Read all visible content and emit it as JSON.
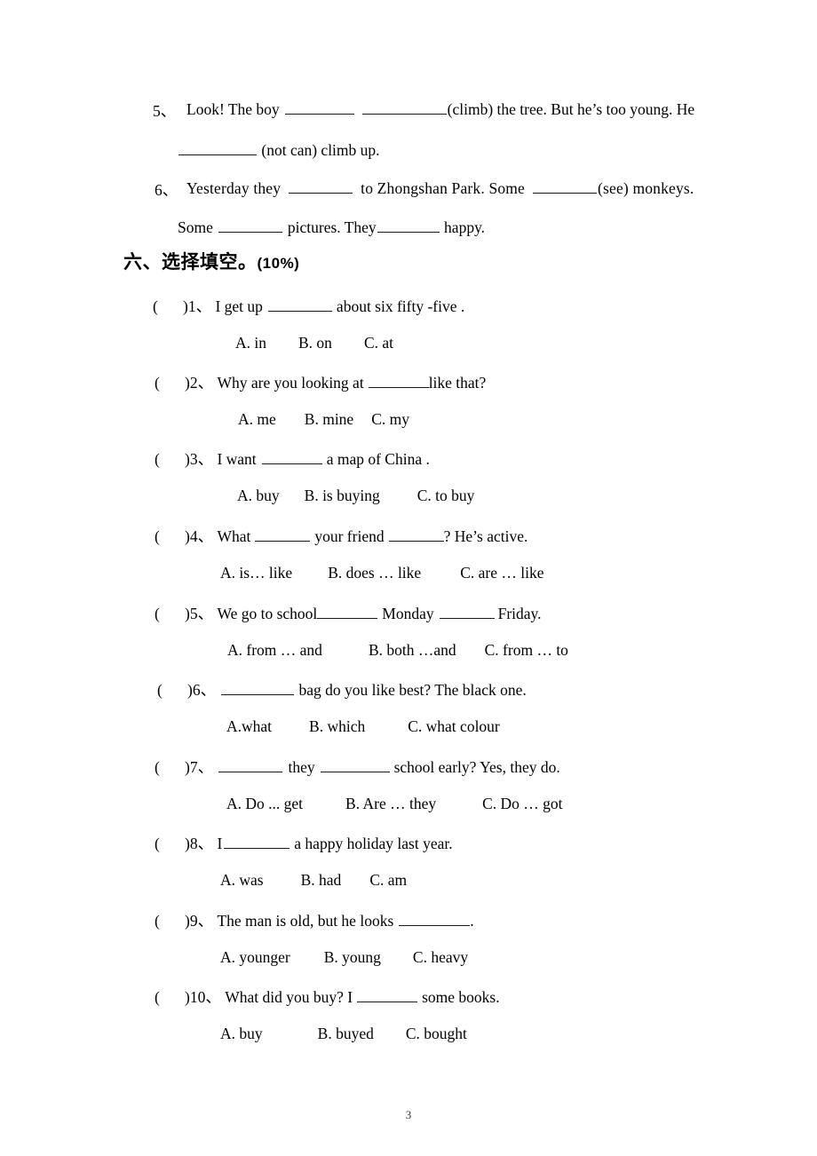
{
  "document": {
    "page_number": "3"
  },
  "fill_in_blanks": [
    {
      "number": "5、",
      "line1_pre": "Look! The boy",
      "blank1_width": 78,
      "blank2_width": 95,
      "line1_post": "(climb) the tree. But he’s too young. He",
      "line2_blank_width": 88,
      "line2_post": "(not can) climb up."
    },
    {
      "number": "6、",
      "line1_pre": "Yesterday  they",
      "blank1_width": 72,
      "line1_mid": "to Zhongshan  Park.  Some",
      "blank2_width": 72,
      "line1_post": "(see)  monkeys.",
      "line2_pre": "Some",
      "line2_blank1_width": 72,
      "line2_mid": "pictures. They",
      "line2_blank2_width": 70,
      "line2_post": "happy."
    }
  ],
  "section": {
    "label": "六、选择填空。",
    "score": "(10%)"
  },
  "questions": [
    {
      "paren": "(",
      "close": ")",
      "num": "1、",
      "pre": "I get up",
      "blank_width": 72,
      "post": "about six fifty -five .",
      "options": [
        "A. in",
        "B. on",
        "C. at"
      ],
      "opt_gaps": [
        36,
        36
      ]
    },
    {
      "paren": "(",
      "close": ")",
      "num": "2、",
      "pre": "Why are you looking at",
      "blank_width": 68,
      "post": "like that?",
      "post_tight": true,
      "options": [
        "A. me",
        "B. mine",
        "C. my"
      ],
      "opt_gaps": [
        32,
        20
      ]
    },
    {
      "paren": "(",
      "close": ")",
      "num": "3、",
      "pre": "I want",
      "blank_width": 68,
      "post": "a map of China .",
      "options": [
        "A. buy",
        "B. is buying",
        "C. to buy"
      ],
      "opt_gaps": [
        28,
        42
      ]
    },
    {
      "paren": "(",
      "close": ")",
      "num": "4、",
      "pre": "What",
      "blank_width": 62,
      "mid": "your friend",
      "blank2_width": 62,
      "post": "? He’s active.",
      "post_tight": true,
      "options": [
        "A. is… like",
        "B. does … like",
        "C. are … like"
      ],
      "opt_gaps": [
        40,
        44
      ]
    },
    {
      "paren": "(",
      "close": ")",
      "num": "5、",
      "pre": "We go to school",
      "pre_tight": true,
      "blank_width": 68,
      "mid": "Monday",
      "blank2_width": 62,
      "post": "Friday.",
      "options": [
        "A. from … and",
        "B. both …and",
        "C. from … to"
      ],
      "opt_gaps": [
        52,
        32
      ]
    },
    {
      "paren": "(",
      "close": ")",
      "num": "6、",
      "pre": "",
      "blank_width": 82,
      "post": "bag do you like best? The black one.",
      "options": [
        "A.what",
        "B. which",
        "C. what colour"
      ],
      "opt_gaps": [
        42,
        48
      ]
    },
    {
      "paren": "(",
      "close": ")",
      "num": "7、",
      "pre": "",
      "blank_width": 72,
      "mid": "they",
      "blank2_width": 78,
      "post": "school early? Yes, they do.",
      "options": [
        "A. Do ... get",
        "B. Are … they",
        "C. Do … got"
      ],
      "opt_gaps": [
        48,
        52
      ]
    },
    {
      "paren": "(",
      "close": ")",
      "num": "8、",
      "pre": "I",
      "blank_width": 74,
      "post": "a happy holiday last year.",
      "options": [
        "A. was",
        "B. had",
        "C. am"
      ],
      "opt_gaps": [
        42,
        32
      ]
    },
    {
      "paren": "(",
      "close": ")",
      "num": "9、",
      "pre": "The man is old, but he looks",
      "blank_width": 80,
      "post": ".",
      "post_tight": true,
      "options": [
        "A. younger",
        "B. young",
        "C. heavy"
      ],
      "opt_gaps": [
        38,
        36
      ]
    },
    {
      "paren": "(",
      "close": ")",
      "num": "10、",
      "pre": "What did you buy? I",
      "blank_width": 68,
      "post": "some books.",
      "options": [
        "A. buy",
        "B. buyed",
        "C. bought"
      ],
      "opt_gaps": [
        62,
        36
      ]
    }
  ]
}
